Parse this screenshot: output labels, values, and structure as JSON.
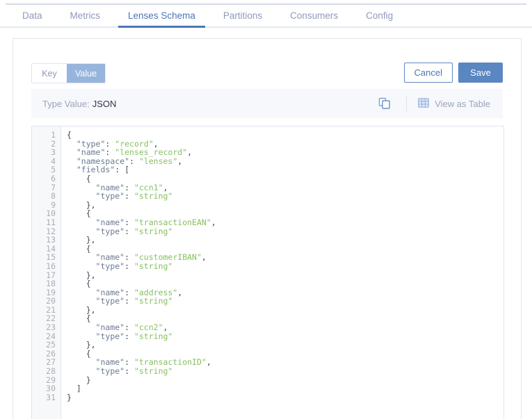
{
  "tabs": [
    {
      "label": "Data",
      "active": false
    },
    {
      "label": "Metrics",
      "active": false
    },
    {
      "label": "Lenses Schema",
      "active": true
    },
    {
      "label": "Partitions",
      "active": false
    },
    {
      "label": "Consumers",
      "active": false
    },
    {
      "label": "Config",
      "active": false
    }
  ],
  "toolbar": {
    "segmented": [
      {
        "label": "Key",
        "active": false
      },
      {
        "label": "Value",
        "active": true
      }
    ],
    "cancel_label": "Cancel",
    "save_label": "Save"
  },
  "typebar": {
    "label": "Type Value:",
    "value": "JSON",
    "copy_icon": "copy-icon",
    "table_icon": "table-grid-icon",
    "view_as_table_label": "View as Table"
  },
  "editor": {
    "line_numbers": [
      1,
      2,
      3,
      4,
      5,
      6,
      7,
      8,
      9,
      10,
      11,
      12,
      13,
      14,
      15,
      16,
      17,
      18,
      19,
      20,
      21,
      22,
      23,
      24,
      25,
      26,
      27,
      28,
      29,
      30,
      31
    ],
    "lines": [
      {
        "n": 1,
        "tokens": [
          {
            "t": "p",
            "v": "{"
          }
        ]
      },
      {
        "n": 2,
        "tokens": [
          {
            "t": "p",
            "v": "  "
          },
          {
            "t": "k",
            "v": "\"type\""
          },
          {
            "t": "p",
            "v": ": "
          },
          {
            "t": "s",
            "v": "\"record\""
          },
          {
            "t": "p",
            "v": ","
          }
        ]
      },
      {
        "n": 3,
        "tokens": [
          {
            "t": "p",
            "v": "  "
          },
          {
            "t": "k",
            "v": "\"name\""
          },
          {
            "t": "p",
            "v": ": "
          },
          {
            "t": "s",
            "v": "\"lenses_record\""
          },
          {
            "t": "p",
            "v": ","
          }
        ]
      },
      {
        "n": 4,
        "tokens": [
          {
            "t": "p",
            "v": "  "
          },
          {
            "t": "k",
            "v": "\"namespace\""
          },
          {
            "t": "p",
            "v": ": "
          },
          {
            "t": "s",
            "v": "\"lenses\""
          },
          {
            "t": "p",
            "v": ","
          }
        ]
      },
      {
        "n": 5,
        "tokens": [
          {
            "t": "p",
            "v": "  "
          },
          {
            "t": "k",
            "v": "\"fields\""
          },
          {
            "t": "p",
            "v": ": ["
          }
        ]
      },
      {
        "n": 6,
        "tokens": [
          {
            "t": "p",
            "v": "    {"
          }
        ]
      },
      {
        "n": 7,
        "tokens": [
          {
            "t": "p",
            "v": "      "
          },
          {
            "t": "k",
            "v": "\"name\""
          },
          {
            "t": "p",
            "v": ": "
          },
          {
            "t": "s",
            "v": "\"ccn1\""
          },
          {
            "t": "p",
            "v": ","
          }
        ]
      },
      {
        "n": 8,
        "tokens": [
          {
            "t": "p",
            "v": "      "
          },
          {
            "t": "k",
            "v": "\"type\""
          },
          {
            "t": "p",
            "v": ": "
          },
          {
            "t": "s",
            "v": "\"string\""
          }
        ]
      },
      {
        "n": 9,
        "tokens": [
          {
            "t": "p",
            "v": "    },"
          }
        ]
      },
      {
        "n": 10,
        "tokens": [
          {
            "t": "p",
            "v": "    {"
          }
        ]
      },
      {
        "n": 11,
        "tokens": [
          {
            "t": "p",
            "v": "      "
          },
          {
            "t": "k",
            "v": "\"name\""
          },
          {
            "t": "p",
            "v": ": "
          },
          {
            "t": "s",
            "v": "\"transactionEAN\""
          },
          {
            "t": "p",
            "v": ","
          }
        ]
      },
      {
        "n": 12,
        "tokens": [
          {
            "t": "p",
            "v": "      "
          },
          {
            "t": "k",
            "v": "\"type\""
          },
          {
            "t": "p",
            "v": ": "
          },
          {
            "t": "s",
            "v": "\"string\""
          }
        ]
      },
      {
        "n": 13,
        "tokens": [
          {
            "t": "p",
            "v": "    },"
          }
        ]
      },
      {
        "n": 14,
        "tokens": [
          {
            "t": "p",
            "v": "    {"
          }
        ]
      },
      {
        "n": 15,
        "tokens": [
          {
            "t": "p",
            "v": "      "
          },
          {
            "t": "k",
            "v": "\"name\""
          },
          {
            "t": "p",
            "v": ": "
          },
          {
            "t": "s",
            "v": "\"customerIBAN\""
          },
          {
            "t": "p",
            "v": ","
          }
        ]
      },
      {
        "n": 16,
        "tokens": [
          {
            "t": "p",
            "v": "      "
          },
          {
            "t": "k",
            "v": "\"type\""
          },
          {
            "t": "p",
            "v": ": "
          },
          {
            "t": "s",
            "v": "\"string\""
          }
        ]
      },
      {
        "n": 17,
        "tokens": [
          {
            "t": "p",
            "v": "    },"
          }
        ]
      },
      {
        "n": 18,
        "tokens": [
          {
            "t": "p",
            "v": "    {"
          }
        ]
      },
      {
        "n": 19,
        "tokens": [
          {
            "t": "p",
            "v": "      "
          },
          {
            "t": "k",
            "v": "\"name\""
          },
          {
            "t": "p",
            "v": ": "
          },
          {
            "t": "s",
            "v": "\"address\""
          },
          {
            "t": "p",
            "v": ","
          }
        ]
      },
      {
        "n": 20,
        "tokens": [
          {
            "t": "p",
            "v": "      "
          },
          {
            "t": "k",
            "v": "\"type\""
          },
          {
            "t": "p",
            "v": ": "
          },
          {
            "t": "s",
            "v": "\"string\""
          }
        ]
      },
      {
        "n": 21,
        "tokens": [
          {
            "t": "p",
            "v": "    },"
          }
        ]
      },
      {
        "n": 22,
        "tokens": [
          {
            "t": "p",
            "v": "    {"
          }
        ]
      },
      {
        "n": 23,
        "tokens": [
          {
            "t": "p",
            "v": "      "
          },
          {
            "t": "k",
            "v": "\"name\""
          },
          {
            "t": "p",
            "v": ": "
          },
          {
            "t": "s",
            "v": "\"ccn2\""
          },
          {
            "t": "p",
            "v": ","
          }
        ]
      },
      {
        "n": 24,
        "tokens": [
          {
            "t": "p",
            "v": "      "
          },
          {
            "t": "k",
            "v": "\"type\""
          },
          {
            "t": "p",
            "v": ": "
          },
          {
            "t": "s",
            "v": "\"string\""
          }
        ]
      },
      {
        "n": 25,
        "tokens": [
          {
            "t": "p",
            "v": "    },"
          }
        ]
      },
      {
        "n": 26,
        "tokens": [
          {
            "t": "p",
            "v": "    {"
          }
        ]
      },
      {
        "n": 27,
        "tokens": [
          {
            "t": "p",
            "v": "      "
          },
          {
            "t": "k",
            "v": "\"name\""
          },
          {
            "t": "p",
            "v": ": "
          },
          {
            "t": "s",
            "v": "\"transactionID\""
          },
          {
            "t": "p",
            "v": ","
          }
        ]
      },
      {
        "n": 28,
        "tokens": [
          {
            "t": "p",
            "v": "      "
          },
          {
            "t": "k",
            "v": "\"type\""
          },
          {
            "t": "p",
            "v": ": "
          },
          {
            "t": "s",
            "v": "\"string\""
          }
        ]
      },
      {
        "n": 29,
        "tokens": [
          {
            "t": "p",
            "v": "    }"
          }
        ]
      },
      {
        "n": 30,
        "tokens": [
          {
            "t": "p",
            "v": "  ]"
          }
        ]
      },
      {
        "n": 31,
        "tokens": [
          {
            "t": "p",
            "v": "}"
          }
        ]
      }
    ]
  },
  "colors": {
    "accent": "#4a76b8",
    "primary_button": "#5a86c2",
    "segment_active": "#97b5dc",
    "string_token": "#86c05f",
    "key_token": "#6b7a93",
    "inactive_tab": "#8e9ab9"
  }
}
